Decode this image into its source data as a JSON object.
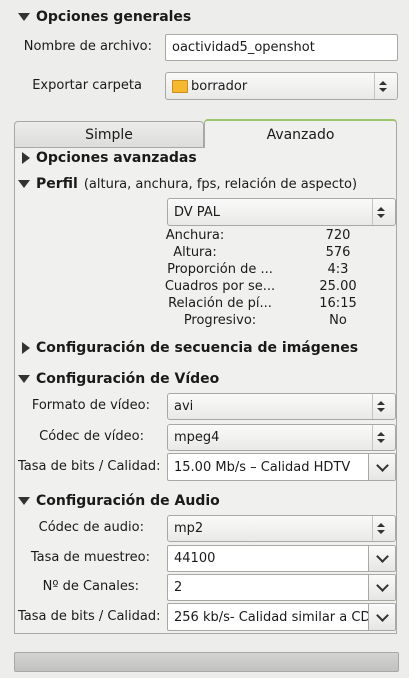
{
  "general": {
    "section_title": "Opciones generales",
    "filename_label": "Nombre de archivo:",
    "filename_value": "oactividad5_openshot",
    "export_label": "Exportar carpeta",
    "export_value": "borrador"
  },
  "tabs": [
    {
      "label": "Simple"
    },
    {
      "label": "Avanzado"
    }
  ],
  "advanced": {
    "options_title": "Opciones avanzadas",
    "profile_title": "Perfil",
    "profile_hint": "(altura, anchura, fps, relación de aspecto)",
    "profile_value": "DV PAL",
    "profile_props": [
      {
        "label": "Anchura:",
        "value": "720"
      },
      {
        "label": "Altura:",
        "value": "576"
      },
      {
        "label": "Proporción de ...",
        "value": "4:3"
      },
      {
        "label": "Cuadros por se...",
        "value": "25.00"
      },
      {
        "label": "Relación de pí...",
        "value": "16:15"
      },
      {
        "label": "Progresivo:",
        "value": "No"
      }
    ],
    "image_seq_title": "Configuración de secuencia de imágenes",
    "video": {
      "title": "Configuración de Vídeo",
      "format_label": "Formato de vídeo:",
      "format_value": "avi",
      "codec_label": "Códec de vídeo:",
      "codec_value": "mpeg4",
      "bitrate_label": "Tasa de bits / Calidad:",
      "bitrate_value": "15.00 Mb/s – Calidad HDTV"
    },
    "audio": {
      "title": "Configuración de Audio",
      "codec_label": "Códec de audio:",
      "codec_value": "mp2",
      "samplerate_label": "Tasa de muestreo:",
      "samplerate_value": "44100",
      "channels_label": "Nº de Canales:",
      "channels_value": "2",
      "bitrate_label": "Tasa de bits / Calidad:",
      "bitrate_value": "256 kb/s- Calidad similar a CD"
    }
  },
  "progress": {
    "fraction": 0
  }
}
